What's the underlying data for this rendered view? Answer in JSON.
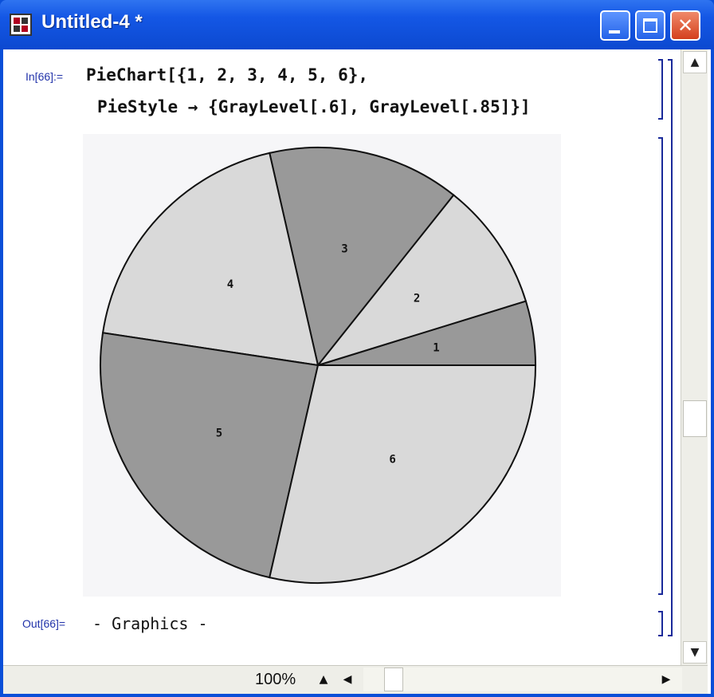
{
  "window": {
    "title": "Untitled-4 *"
  },
  "notebook": {
    "in_label": "In[66]:=",
    "input_line1": "PieChart[{1, 2, 3, 4, 5, 6},",
    "input_line2": "PieStyle → {GrayLevel[.6], GrayLevel[.85]}]",
    "out_label": "Out[66]=",
    "output_text": "- Graphics -"
  },
  "statusbar": {
    "zoom": "100%"
  },
  "icons": {
    "zoom_up": "triangle-up-icon",
    "scroll_left": "triangle-left-icon",
    "scroll_right": "triangle-right-icon",
    "scroll_up": "triangle-up-icon",
    "scroll_down": "triangle-down-icon"
  },
  "colors": {
    "dark_slice": "#999999",
    "light_slice": "#d9d9d9",
    "titlebar": "#1457e5"
  },
  "chart_data": {
    "type": "pie",
    "categories": [
      "1",
      "2",
      "3",
      "4",
      "5",
      "6"
    ],
    "values": [
      1,
      2,
      3,
      4,
      5,
      6
    ],
    "slice_colors": [
      "#999999",
      "#d9d9d9",
      "#999999",
      "#d9d9d9",
      "#999999",
      "#d9d9d9"
    ],
    "start": "3 o'clock",
    "direction": "counterclockwise",
    "legend": "none"
  }
}
